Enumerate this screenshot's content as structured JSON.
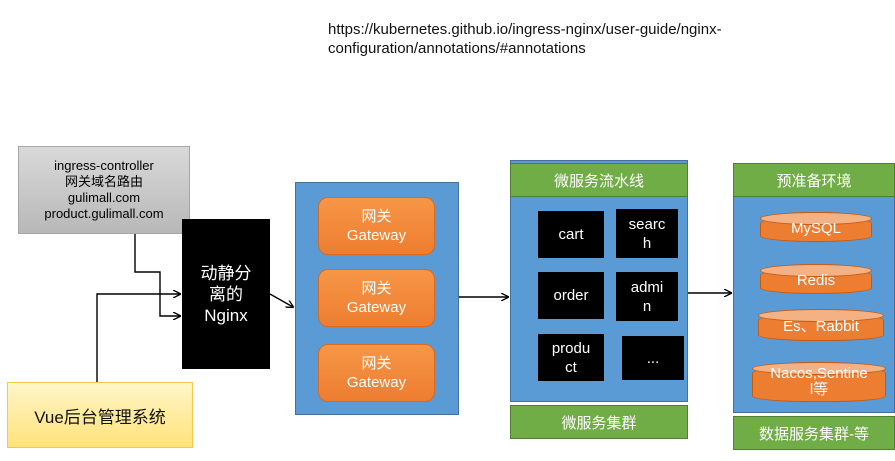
{
  "url_note": {
    "line1": "https://kubernetes.github.io/ingress-nginx/user-guide/nginx-",
    "line2": "configuration/annotations/#annotations"
  },
  "ingress": {
    "lines": [
      "ingress-controller",
      "网关域名路由",
      "gulimall.com",
      "product.gulimall.com"
    ]
  },
  "vue_box": {
    "label": "Vue后台管理系统"
  },
  "nginx": {
    "lines": [
      "动静分",
      "离的",
      "Nginx"
    ]
  },
  "gateways": [
    {
      "line1": "网关",
      "line2": "Gateway"
    },
    {
      "line1": "网关",
      "line2": "Gateway"
    },
    {
      "line1": "网关",
      "line2": "Gateway"
    }
  ],
  "microservices": {
    "header": "微服务流水线",
    "footer": "微服务集群",
    "services": [
      {
        "lines": [
          "cart"
        ]
      },
      {
        "lines": [
          "searc",
          "h"
        ]
      },
      {
        "lines": [
          "order"
        ]
      },
      {
        "lines": [
          "admi",
          "n"
        ]
      },
      {
        "lines": [
          "produ",
          "ct"
        ]
      },
      {
        "lines": [
          "..."
        ]
      }
    ]
  },
  "data_services": {
    "header": "预准备环境",
    "footer": "数据服务集群-等",
    "stores": [
      {
        "lines": [
          "MySQL"
        ]
      },
      {
        "lines": [
          "Redis"
        ]
      },
      {
        "lines": [
          "Es、Rabbit"
        ]
      },
      {
        "lines": [
          "Nacos,Sentine",
          "l等"
        ]
      }
    ]
  },
  "colors": {
    "panel_blue": "#5b9bd5",
    "gateway_orange": "#ed7d31",
    "header_green": "#70ad47",
    "nginx_black": "#000000",
    "ingress_gray": "#bfbfbf",
    "vue_yellow": "#ffe27a"
  }
}
